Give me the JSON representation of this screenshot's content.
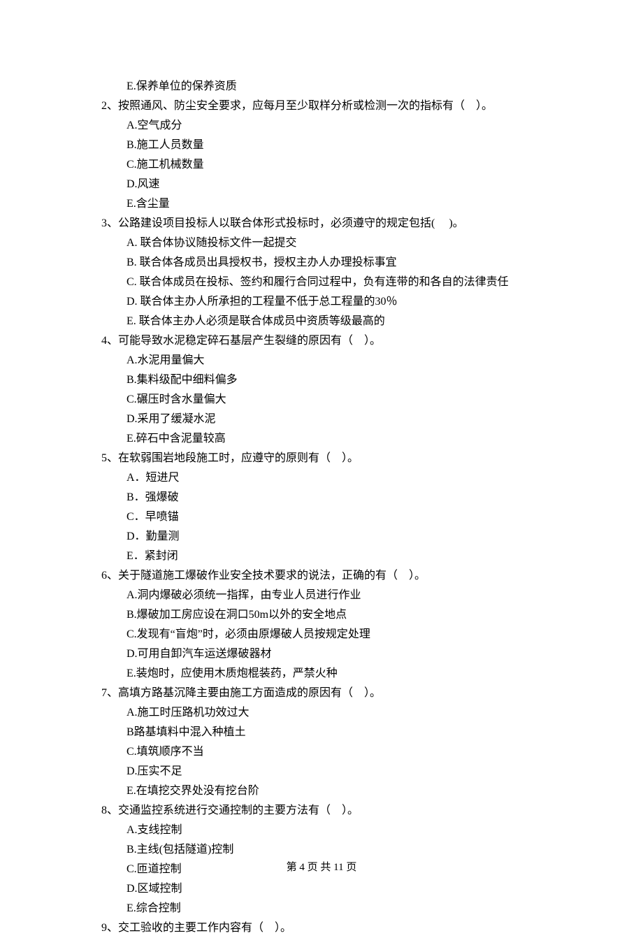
{
  "leading_option": "E.保养单位的保养资质",
  "questions": [
    {
      "num": "2、",
      "text": "按照通风、防尘安全要求，应每月至少取样分析或检测一次的指标有（    ）。",
      "options": [
        "A.空气成分",
        "B.施工人员数量",
        "C.施工机械数量",
        "D.风速",
        "E.含尘量"
      ]
    },
    {
      "num": "3、",
      "text": "公路建设项目投标人以联合体形式投标时，必须遵守的规定包括(     )。",
      "options": [
        "A. 联合体协议随投标文件一起提交",
        "B. 联合体各成员出具授权书，授权主办人办理投标事宜",
        "C. 联合体成员在投标、签约和履行合同过程中，负有连带的和各自的法律责任",
        "D. 联合体主办人所承担的工程量不低于总工程量的30％",
        "E. 联合体主办人必须是联合体成员中资质等级最高的"
      ]
    },
    {
      "num": "4、",
      "text": "可能导致水泥稳定碎石基层产生裂缝的原因有（    ）。",
      "options": [
        "A.水泥用量偏大",
        "B.集料级配中细料偏多",
        "C.碾压时含水量偏大",
        "D.采用了缓凝水泥",
        "E.碎石中含泥量较高"
      ]
    },
    {
      "num": "5、",
      "text": "在软弱围岩地段施工时，应遵守的原则有（    ）。",
      "options": [
        "A．短进尺",
        "B．强爆破",
        "C．早喷锚",
        "D．勤量测",
        "E．紧封闭"
      ]
    },
    {
      "num": "6、",
      "text": "关于隧道施工爆破作业安全技术要求的说法，正确的有（    ）。",
      "options": [
        "A.洞内爆破必须统一指挥，由专业人员进行作业",
        "B.爆破加工房应设在洞口50m以外的安全地点",
        "C.发现有“盲炮”时，必须由原爆破人员按规定处理",
        "D.可用自卸汽车运送爆破器材",
        "E.装炮时，应使用木质炮棍装药，严禁火种"
      ]
    },
    {
      "num": "7、",
      "text": "高填方路基沉降主要由施工方面造成的原因有（    ）。",
      "options": [
        "A.施工时压路机功效过大",
        "B路基填料中混入种植土",
        "C.填筑顺序不当",
        "D.压实不足",
        "E.在填挖交界处没有挖台阶"
      ]
    },
    {
      "num": "8、",
      "text": "交通监控系统进行交通控制的主要方法有（    ）。",
      "options": [
        "A.支线控制",
        "B.主线(包括隧道)控制",
        "C.匝道控制",
        "D.区域控制",
        "E.综合控制"
      ]
    },
    {
      "num": "9、",
      "text": "交工验收的主要工作内容有（    ）。",
      "options": []
    }
  ],
  "footer": "第 4 页 共 11 页"
}
